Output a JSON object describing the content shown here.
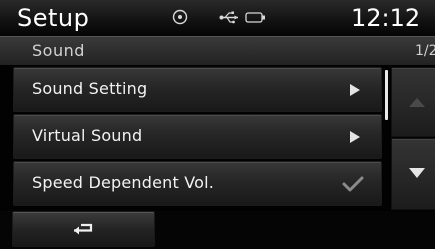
{
  "status_bar": {
    "title": "Setup",
    "clock": "12:12",
    "icons": [
      "disc-icon",
      "usb-icon",
      "battery-icon"
    ]
  },
  "sub_header": {
    "title": "Sound",
    "page_indicator": "1/2"
  },
  "menu": {
    "items": [
      {
        "label": "Sound Setting",
        "indicator": "arrow-right-icon"
      },
      {
        "label": "Virtual Sound",
        "indicator": "arrow-right-icon"
      },
      {
        "label": "Speed Dependent Vol.",
        "indicator": "checkmark-icon",
        "checked": true
      }
    ]
  },
  "scroll": {
    "up_icon": "arrow-up-icon",
    "down_icon": "arrow-down-icon",
    "up_enabled": false,
    "down_enabled": true
  },
  "bottom_bar": {
    "back_icon": "return-arrow-icon"
  },
  "colors": {
    "background": "#020202",
    "text": "#f2f2f2",
    "subtext": "#d2d2d2",
    "disabled_icon": "#4a4a4a",
    "check_color": "#8a8a8a"
  }
}
